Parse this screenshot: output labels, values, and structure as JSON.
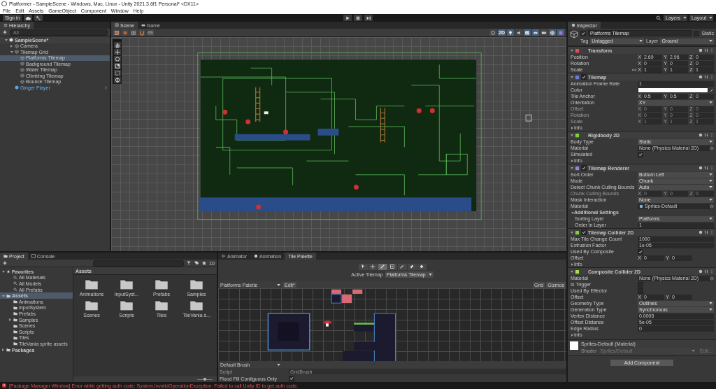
{
  "window": {
    "title": "Platformer - SampleScene - Windows, Mac, Linux - Unity 2021.3.6f1 Personal* <DX11>"
  },
  "menu": [
    "File",
    "Edit",
    "Assets",
    "GameObject",
    "Component",
    "Window",
    "Help"
  ],
  "toolbar": {
    "sign_in": "Sign in",
    "layers": "Layers",
    "layout": "Layout"
  },
  "hierarchy": {
    "title": "Hierarchy",
    "search_placeholder": "All",
    "tree": [
      {
        "label": "SampleScene*",
        "kind": "scene",
        "selected": false,
        "expanded": true,
        "children": [
          {
            "label": "Camera",
            "kind": "object",
            "selected": false,
            "expanded": false
          },
          {
            "label": "Tilemap Grid",
            "kind": "object",
            "selected": false,
            "expanded": true,
            "children": [
              {
                "label": "Platforms Tilemap",
                "kind": "object",
                "selected": true
              },
              {
                "label": "Background Tilemap",
                "kind": "object",
                "selected": false
              },
              {
                "label": "Water Tilemap",
                "kind": "object",
                "selected": false
              },
              {
                "label": "Climbing Tilemap",
                "kind": "object",
                "selected": false
              },
              {
                "label": "Bounce Tilemap",
                "kind": "object",
                "selected": false
              }
            ]
          },
          {
            "label": "Ginger Player",
            "kind": "prefab",
            "selected": false
          }
        ]
      }
    ]
  },
  "scene_view": {
    "tabs": [
      {
        "label": "Scene",
        "kind": "scene",
        "selected": true
      },
      {
        "label": "Game",
        "kind": "game",
        "selected": false
      }
    ],
    "toggles": [
      {
        "kind": "shading",
        "on": false
      },
      {
        "kind": "dimension",
        "label": "2D",
        "on": true
      },
      {
        "kind": "lighting",
        "on": true
      },
      {
        "kind": "audio",
        "on": false
      },
      {
        "kind": "effects",
        "on": true
      },
      {
        "kind": "visibility",
        "on": true
      },
      {
        "kind": "camera",
        "on": false
      },
      {
        "kind": "gizmos",
        "on": true
      },
      {
        "kind": "grid",
        "on": true
      }
    ]
  },
  "inspector": {
    "title": "Inspector",
    "object": {
      "name": "Platforms Tilemap",
      "active": true,
      "static_label": "Static",
      "static": false,
      "tag_label": "Tag",
      "tag": "Untagged",
      "layer_label": "Layer",
      "layer": "Ground"
    },
    "components": [
      {
        "title": "Transform",
        "kind": "transform",
        "expanded": true,
        "rows": [
          {
            "label": "Position",
            "kind": "vector",
            "axes": [
              {
                "axis": "X",
                "value": "2.69"
              },
              {
                "axis": "Y",
                "value": "2.96"
              },
              {
                "axis": "Z",
                "value": "0"
              }
            ]
          },
          {
            "label": "Rotation",
            "kind": "vector",
            "axes": [
              {
                "axis": "X",
                "value": "0"
              },
              {
                "axis": "Y",
                "value": "0"
              },
              {
                "axis": "Z",
                "value": "0"
              }
            ]
          },
          {
            "label": "Scale",
            "kind": "vector",
            "linked": true,
            "axes": [
              {
                "axis": "X",
                "value": "1"
              },
              {
                "axis": "Y",
                "value": "1"
              },
              {
                "axis": "Z",
                "value": "1"
              }
            ]
          }
        ]
      },
      {
        "title": "Tilemap",
        "kind": "tilemap",
        "expanded": true,
        "enabled": true,
        "rows": [
          {
            "label": "Animation Frame Rate",
            "kind": "field",
            "value": "1",
            "disabled": false
          },
          {
            "label": "Color",
            "kind": "color",
            "color": "#ffffff",
            "disabled": false
          },
          {
            "label": "Tile Anchor",
            "kind": "vector",
            "disabled": false,
            "axes": [
              {
                "axis": "X",
                "value": "0.5"
              },
              {
                "axis": "Y",
                "value": "0.5"
              },
              {
                "axis": "Z",
                "value": "0"
              }
            ]
          },
          {
            "label": "Orientation",
            "kind": "dropdown",
            "value": "XY",
            "disabled": false
          },
          {
            "label": "Offset",
            "kind": "vector",
            "disabled": true,
            "axes": [
              {
                "axis": "X",
                "value": "0"
              },
              {
                "axis": "Y",
                "value": "0"
              },
              {
                "axis": "Z",
                "value": "0"
              }
            ]
          },
          {
            "label": "Rotation",
            "kind": "vector",
            "disabled": true,
            "axes": [
              {
                "axis": "X",
                "value": "0"
              },
              {
                "axis": "Y",
                "value": "0"
              },
              {
                "axis": "Z",
                "value": "0"
              }
            ]
          },
          {
            "label": "Scale",
            "kind": "vector",
            "disabled": true,
            "axes": [
              {
                "axis": "X",
                "value": "1"
              },
              {
                "axis": "Y",
                "value": "1"
              },
              {
                "axis": "Z",
                "value": "1"
              }
            ]
          },
          {
            "label": "Info",
            "kind": "foldout",
            "expanded": false,
            "disabled": false
          }
        ]
      },
      {
        "title": "Rigidbody 2D",
        "kind": "rigidbody",
        "expanded": true,
        "rows": [
          {
            "label": "Body Type",
            "kind": "dropdown",
            "value": "Static"
          },
          {
            "label": "Material",
            "kind": "object",
            "value": "None (Physics Material 2D)"
          },
          {
            "label": "Simulated",
            "kind": "check",
            "checked": true
          },
          {
            "label": "Info",
            "kind": "foldout",
            "expanded": false
          }
        ]
      },
      {
        "title": "Tilemap Renderer",
        "kind": "renderer",
        "expanded": true,
        "enabled": true,
        "rows": [
          {
            "label": "Sort Order",
            "kind": "dropdown",
            "value": "Bottom Left",
            "disabled": false
          },
          {
            "label": "Mode",
            "kind": "dropdown",
            "value": "Chunk",
            "disabled": false
          },
          {
            "label": "Detect Chunk Culling Bounds",
            "kind": "dropdown",
            "value": "Auto",
            "disabled": false
          },
          {
            "label": "Chunk Culling Bounds",
            "kind": "vector",
            "disabled": true,
            "axes": [
              {
                "axis": "X",
                "value": "0"
              },
              {
                "axis": "Y",
                "value": "0"
              },
              {
                "axis": "Z",
                "value": "0"
              }
            ]
          },
          {
            "label": "Mask Interaction",
            "kind": "dropdown",
            "value": "None",
            "disabled": false
          },
          {
            "label": "Material",
            "kind": "asset",
            "value": "Sprites-Default",
            "disabled": false
          },
          {
            "label": "Additional Settings",
            "kind": "section",
            "expanded": true,
            "disabled": false,
            "children": [
              {
                "label": "Sorting Layer",
                "kind": "dropdown",
                "value": "Platforms"
              },
              {
                "label": "Order in Layer",
                "kind": "field",
                "value": "1"
              }
            ]
          }
        ]
      },
      {
        "title": "Tilemap Collider 2D",
        "kind": "collider",
        "expanded": true,
        "enabled": true,
        "rows": [
          {
            "label": "Max Tile Change Count",
            "kind": "field",
            "value": "1000"
          },
          {
            "label": "Extrusion Factor",
            "kind": "field",
            "value": "1e-05"
          },
          {
            "label": "Used By Composite",
            "kind": "check",
            "checked": true
          },
          {
            "label": "Offset",
            "kind": "vector",
            "axes": [
              {
                "axis": "X",
                "value": "0"
              },
              {
                "axis": "Y",
                "value": "0"
              }
            ]
          },
          {
            "label": "Info",
            "kind": "foldout",
            "expanded": false
          }
        ]
      },
      {
        "title": "Composite Collider 2D",
        "kind": "composite",
        "expanded": true,
        "rows": [
          {
            "label": "Material",
            "kind": "object",
            "value": "None (Physics Material 2D)"
          },
          {
            "label": "Is Trigger",
            "kind": "check",
            "checked": false
          },
          {
            "label": "Used By Effector",
            "kind": "check",
            "checked": false
          },
          {
            "label": "Offset",
            "kind": "vector",
            "axes": [
              {
                "axis": "X",
                "value": "0"
              },
              {
                "axis": "Y",
                "value": "0"
              }
            ]
          },
          {
            "label": "Geometry Type",
            "kind": "dropdown",
            "value": "Outlines"
          },
          {
            "label": "Generation Type",
            "kind": "dropdown",
            "value": "Synchronous"
          },
          {
            "label": "Vertex Distance",
            "kind": "field",
            "value": "0.0005"
          },
          {
            "label": "Offset Distance",
            "kind": "field",
            "value": "5e-05"
          },
          {
            "label": "Edge Radius",
            "kind": "field",
            "value": "0"
          },
          {
            "label": "Info",
            "kind": "foldout",
            "expanded": false
          }
        ]
      }
    ],
    "material": {
      "name": "Sprites-Default (Material)",
      "shader_label": "Shader",
      "shader": "Sprites/Default",
      "edit": "Edit..."
    },
    "add_component": "Add Component"
  },
  "project": {
    "tabs": [
      {
        "label": "Project",
        "kind": "project",
        "selected": true
      },
      {
        "label": "Console",
        "kind": "console",
        "selected": false
      }
    ],
    "count": "10",
    "zoom_slider": {
      "level": 0.5
    },
    "tree": [
      {
        "label": "Favorites",
        "kind": "favorites",
        "selected": false,
        "expanded": true,
        "children": [
          {
            "label": "All Materials",
            "kind": "search",
            "selected": false
          },
          {
            "label": "All Models",
            "kind": "search",
            "selected": false
          },
          {
            "label": "All Prefabs",
            "kind": "search",
            "selected": false
          }
        ]
      },
      {
        "label": "Assets",
        "kind": "root",
        "selected": true,
        "expanded": true,
        "children": [
          {
            "label": "Animations",
            "kind": "folder",
            "selected": false
          },
          {
            "label": "InputSystem",
            "kind": "folder",
            "selected": false
          },
          {
            "label": "Prefabs",
            "kind": "folder",
            "selected": false
          },
          {
            "label": "Samples",
            "kind": "folder",
            "selected": false,
            "expanded": false
          },
          {
            "label": "Scenes",
            "kind": "folder",
            "selected": false
          },
          {
            "label": "Scripts",
            "kind": "folder",
            "selected": false
          },
          {
            "label": "Tiles",
            "kind": "folder",
            "selected": false
          },
          {
            "label": "TileVania sprite assets",
            "kind": "folder",
            "selected": false
          }
        ]
      },
      {
        "label": "Packages",
        "kind": "root",
        "selected": false,
        "expanded": false
      }
    ],
    "breadcrumb": "Assets",
    "folders": [
      "Animations",
      "InputSyst...",
      "Prefabs",
      "Samples",
      "Scenes",
      "Scripts",
      "Tiles",
      "TileVania s..."
    ]
  },
  "tile_palette": {
    "tabs": [
      {
        "label": "Animator",
        "kind": "animator",
        "selected": false
      },
      {
        "label": "Animation",
        "kind": "animation",
        "selected": false
      },
      {
        "label": "Tile Palette",
        "kind": "palette",
        "selected": true
      }
    ],
    "tools": [
      {
        "kind": "select",
        "selected": false
      },
      {
        "kind": "move",
        "selected": false
      },
      {
        "kind": "paint",
        "selected": true
      },
      {
        "kind": "box",
        "selected": false
      },
      {
        "kind": "picker",
        "selected": false
      },
      {
        "kind": "erase",
        "selected": false
      },
      {
        "kind": "fill",
        "selected": false
      }
    ],
    "active_tilemap_label": "Active Tilemap",
    "active_tilemap": "Platforms Tilemap",
    "palette": "Platforms Palette",
    "edit": "Edit*",
    "grid": "Grid",
    "gizmos": "Gizmos",
    "brush": "Default Brush",
    "script_label": "Script",
    "script": "GridBrush",
    "flood_fill_label": "Flood Fill Contiguous Only",
    "flood_fill": true
  },
  "status_bar": {
    "message": "[Package Manager Window] Error while getting auth code: System.InvalidOperationException: Failed to call Unity ID to get auth code."
  }
}
